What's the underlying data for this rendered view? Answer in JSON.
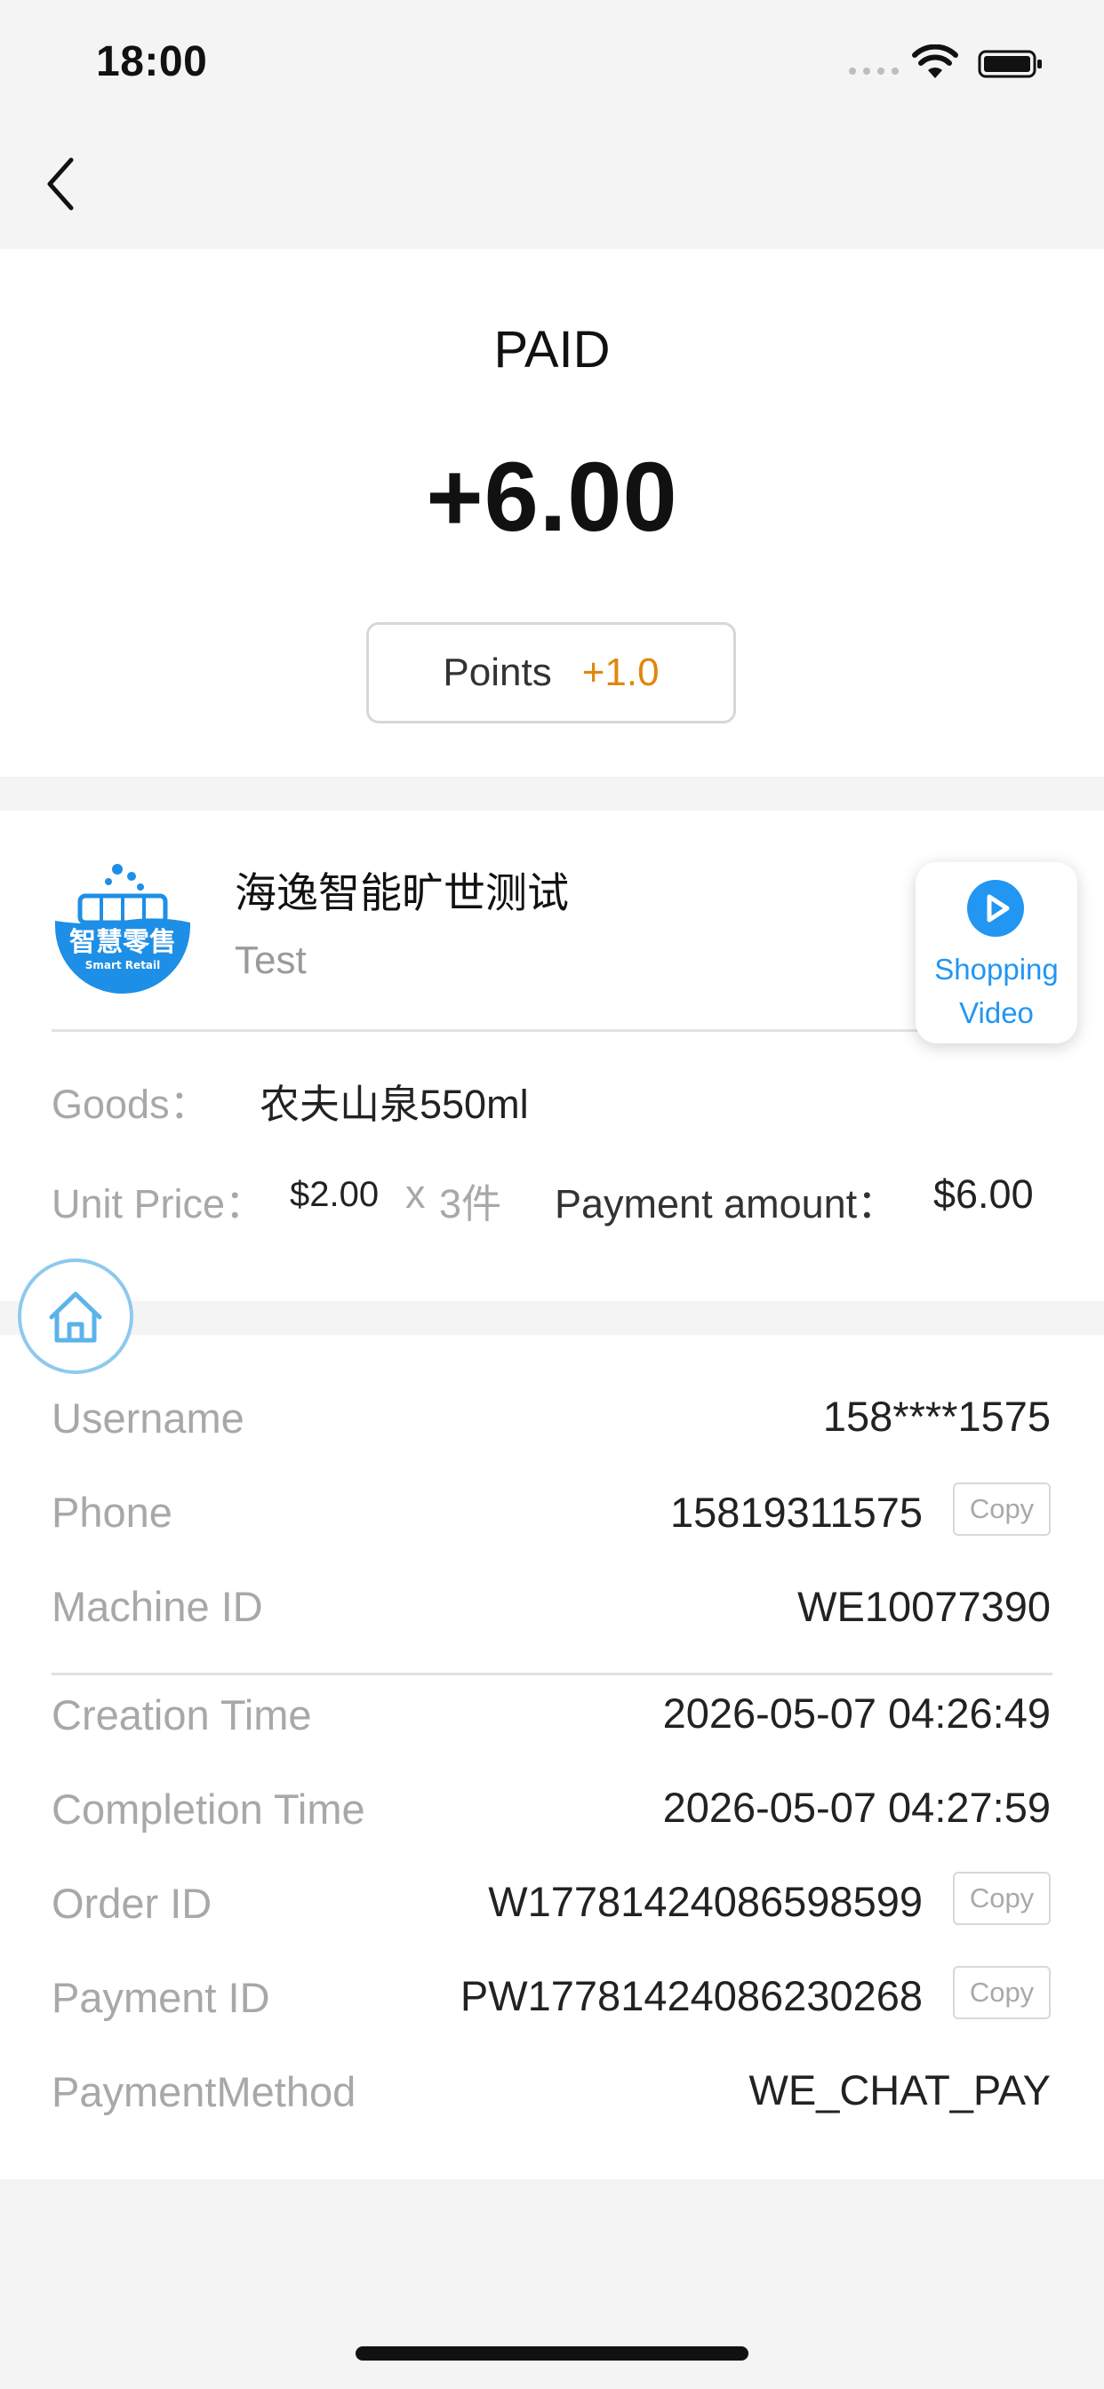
{
  "status_bar": {
    "time": "18:00"
  },
  "header": {
    "status": "PAID",
    "amount": "+6.00",
    "points_label": "Points",
    "points_value": "+1.0",
    "points_color": "#e0870e"
  },
  "store": {
    "name": "海逸智能旷世测试",
    "subtitle": "Test",
    "logo_text": "智慧零售",
    "logo_subtext": "Smart Retail",
    "video_button": {
      "line1": "Shopping",
      "line2": "Video"
    }
  },
  "goods": {
    "goods_label": "Goods：",
    "goods_value": "农夫山泉550ml",
    "unit_price_label": "Unit Price：",
    "unit_price_value": "$2.00",
    "multiply": "x",
    "quantity": "3件",
    "payment_amount_label": "Payment amount：",
    "payment_amount_value": "$6.00"
  },
  "details": {
    "username_label": "Username",
    "username_value": "158****1575",
    "phone_label": "Phone",
    "phone_value": "15819311575",
    "machine_label": "Machine ID",
    "machine_value": "WE10077390",
    "creation_label": "Creation Time",
    "creation_value": "2026-05-07 04:26:49",
    "completion_label": "Completion Time",
    "completion_value": "2026-05-07 04:27:59",
    "order_label": "Order ID",
    "order_value": "W17781424086598599",
    "payment_id_label": "Payment ID",
    "payment_id_value": "PW17781424086230268",
    "method_label": "PaymentMethod",
    "method_value": "WE_CHAT_PAY",
    "copy_label": "Copy"
  },
  "colors": {
    "accent_blue": "#2196f3",
    "logo_blue": "#1e8fe6"
  }
}
